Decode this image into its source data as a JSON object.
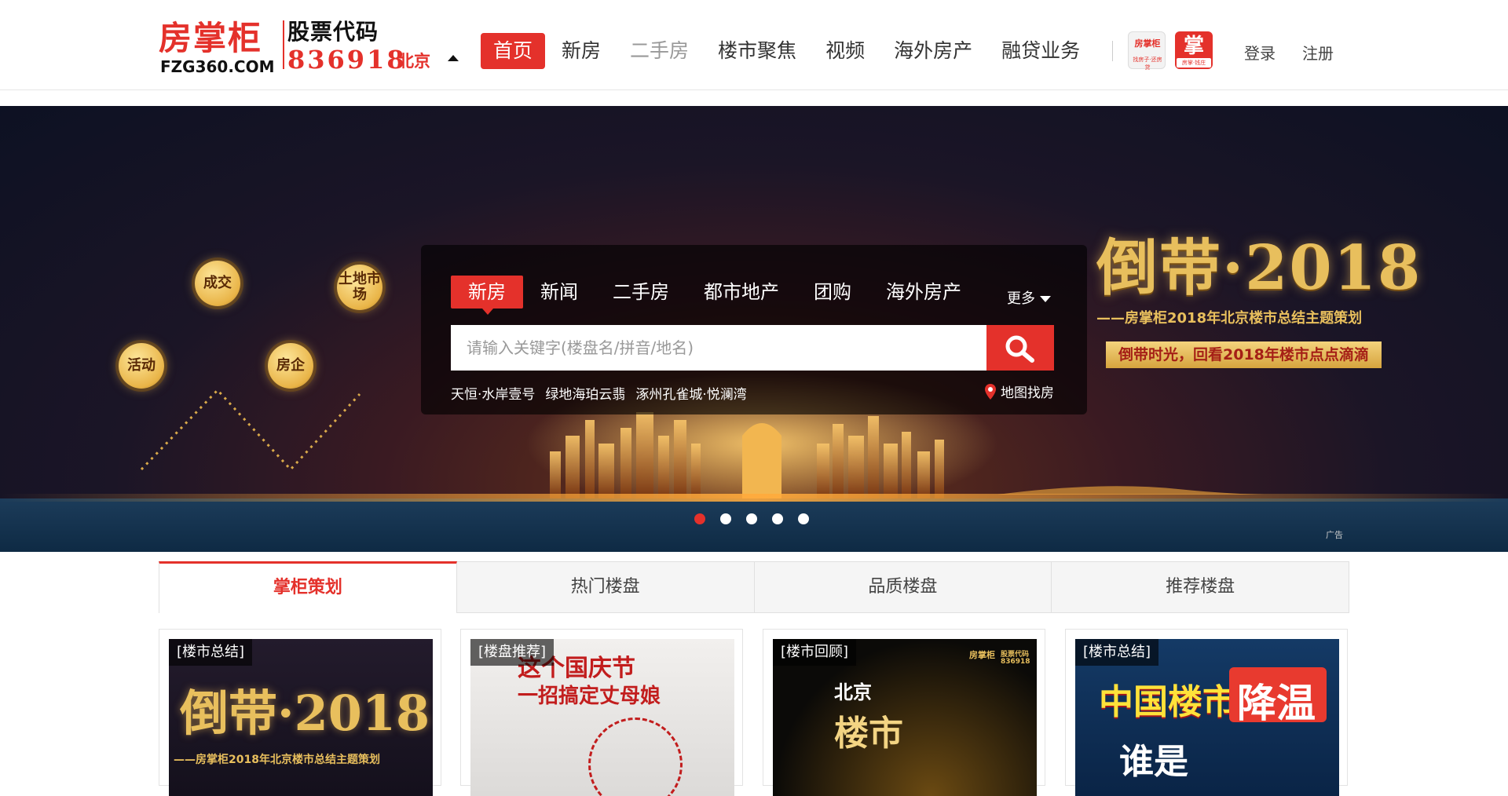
{
  "header": {
    "logo_cn": "房掌柜",
    "logo_en": "FZG360.COM",
    "stock_label": "股票代码",
    "stock_code": "836918",
    "city": "北京",
    "nav": [
      "首页",
      "新房",
      "二手房",
      "楼市聚焦",
      "视频",
      "海外房产",
      "融贷业务"
    ],
    "app1_title": "房掌柜",
    "app1_sub": "找房子·还房贷",
    "app2_title": "掌",
    "app2_sub": "房掌·钱庄",
    "login": "登录",
    "register": "注册"
  },
  "banner": {
    "nodes": [
      "成交",
      "土地市场",
      "活动",
      "房企"
    ],
    "search_tabs": [
      "新房",
      "新闻",
      "二手房",
      "都市地产",
      "团购",
      "海外房产"
    ],
    "more": "更多",
    "search_placeholder": "请输入关键字(楼盘名/拼音/地名)",
    "hot_keywords": [
      "天恒·水岸壹号",
      "绿地海珀云翡",
      "涿州孔雀城·悦澜湾"
    ],
    "map_link": "地图找房",
    "promo_title": "倒带·2018",
    "promo_sub": "——房掌柜2018年北京楼市总结主题策划",
    "promo_badge": "倒带时光，回看2018年楼市点点滴滴",
    "ad_label": "广告",
    "slide_count": 5,
    "active_slide": 1
  },
  "content_tabs": [
    "掌柜策划",
    "热门楼盘",
    "品质楼盘",
    "推荐楼盘"
  ],
  "cards": [
    {
      "tag": "[楼市总结]",
      "caption": "倒带·2018",
      "subcaption": "——房掌柜2018年北京楼市总结主题策划"
    },
    {
      "tag": "[楼盘推荐]",
      "caption": "这个国庆节",
      "subcaption": "一招搞定丈母娘"
    },
    {
      "tag": "[楼市回顾]",
      "caption": "北京",
      "subcaption": "楼市",
      "logo": "房掌柜",
      "logo_sub": "股票代码",
      "logo_code": "836918"
    },
    {
      "tag": "[楼市总结]",
      "caption": "中国楼市",
      "subcaption": "降温",
      "line2": "谁是"
    }
  ],
  "colors": {
    "brand_red": "#e4312b",
    "gold": "#e8bf5d"
  }
}
